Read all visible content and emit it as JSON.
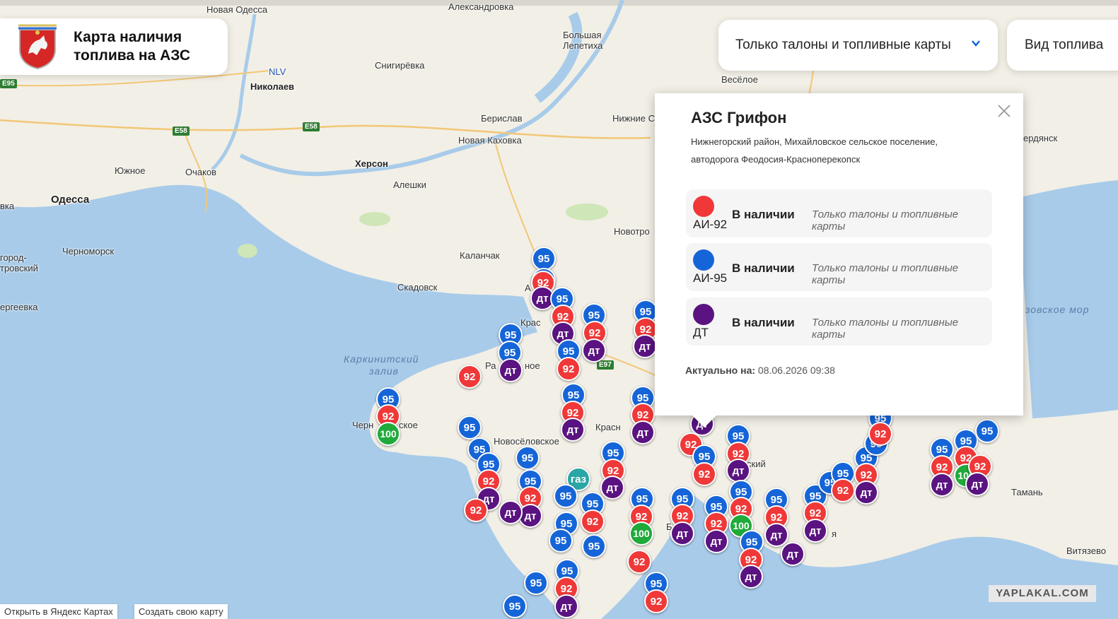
{
  "header": {
    "title": "Карта наличия топлива на АЗС",
    "filter_payment": "Только талоны и топливные карты",
    "filter_fuel": "Вид топлива"
  },
  "popup": {
    "station_name": "АЗС Грифон",
    "address": "Нижнегорский район, Михайловское сельское поселение, автодорога Феодосия-Красноперекопск",
    "fuels": [
      {
        "name": "АИ-92",
        "color": "#f03838",
        "status": "В наличии",
        "note": "Только талоны и топливные карты"
      },
      {
        "name": "АИ-95",
        "color": "#1565d8",
        "status": "В наличии",
        "note": "Только талоны и топливные карты"
      },
      {
        "name": "ДТ",
        "color": "#5a1380",
        "status": "В наличии",
        "note": "Только талоны и топливные карты"
      }
    ],
    "updated_label": "Актуально на:",
    "updated_value": "08.06.2026 09:38"
  },
  "map": {
    "places": {
      "novaya_odessa": "Новая Одесса",
      "aleksandrovka": "Александровка",
      "bolshaya_lepetikha": "Большая Лепетиха",
      "snigirevka": "Снигирёвка",
      "nlv": "NLV",
      "nikolaev": "Николаев",
      "veseloe": "Весёлое",
      "beryslav": "Берислав",
      "nizhnie": "Нижние С",
      "novaya_kakhovka": "Новая Каховка",
      "kherson": "Херсон",
      "yuzhnoe": "Южное",
      "ochakov": "Очаков",
      "aleshki": "Алешки",
      "odessa": "Одесса",
      "vka": "вка",
      "berdyansk": "ердянск",
      "novotroitsk": "Новотро",
      "kalanchak": "Каланчак",
      "gorod": "город-",
      "trovskiy": "тровский",
      "chernomorsk": "Черноморск",
      "skadovsk": "Скадовск",
      "ergeevka": "ергеевка",
      "azov_sea": "зовское мор",
      "karkinit": "Каркинитский",
      "zaliv": "залив",
      "cherno": "Черн",
      "skoe": "ское",
      "novoselovskoe": "Новосёловское",
      "kras": "Крас",
      "ra": "Ра",
      "noe": "ное",
      "krasn": "Красн",
      "a": "А",
      "skiy": "ский",
      "taman": "Тамань",
      "vityazevo": "Витязево",
      "ya": "я",
      "b": "Б"
    },
    "roads": {
      "e95": "E95",
      "e58a": "E58",
      "e58b": "E58",
      "e97": "E97"
    },
    "markers": [
      [
        "95",
        769,
        366
      ],
      [
        "95",
        769,
        396
      ],
      [
        "92",
        768,
        400
      ],
      [
        "дт",
        767,
        422
      ],
      [
        "95",
        795,
        423
      ],
      [
        "92",
        796,
        448
      ],
      [
        "дт",
        796,
        472
      ],
      [
        "95",
        840,
        446
      ],
      [
        "92",
        841,
        471
      ],
      [
        "дт",
        840,
        496
      ],
      [
        "95",
        913,
        441
      ],
      [
        "92",
        913,
        466
      ],
      [
        "дт",
        912,
        490
      ],
      [
        "95",
        722,
        474
      ],
      [
        "95",
        721,
        499
      ],
      [
        "дт",
        722,
        524
      ],
      [
        "92",
        664,
        533
      ],
      [
        "95",
        804,
        497
      ],
      [
        "92",
        804,
        522
      ],
      [
        "95",
        549,
        565
      ],
      [
        "92",
        549,
        589
      ],
      [
        "100",
        549,
        614
      ],
      [
        "95",
        811,
        559
      ],
      [
        "92",
        810,
        584
      ],
      [
        "дт",
        810,
        608
      ],
      [
        "95",
        909,
        563
      ],
      [
        "92",
        909,
        587
      ],
      [
        "дт",
        909,
        612
      ],
      [
        "95",
        664,
        605
      ],
      [
        "95",
        678,
        636
      ],
      [
        "95",
        691,
        657
      ],
      [
        "92",
        691,
        681
      ],
      [
        "дт",
        691,
        706
      ],
      [
        "95",
        746,
        648
      ],
      [
        "95",
        750,
        681
      ],
      [
        "92",
        750,
        705
      ],
      [
        "дт",
        750,
        730
      ],
      [
        "92",
        673,
        722
      ],
      [
        "дт",
        722,
        725
      ],
      [
        "95",
        867,
        641
      ],
      [
        "92",
        867,
        666
      ],
      [
        "дт",
        866,
        690
      ],
      [
        "газ",
        818,
        678
      ],
      [
        "95",
        800,
        702
      ],
      [
        "95",
        838,
        713
      ],
      [
        "92",
        838,
        738
      ],
      [
        "95",
        908,
        706
      ],
      [
        "92",
        907,
        731
      ],
      [
        "100",
        907,
        755
      ],
      [
        "95",
        801,
        741
      ],
      [
        "95",
        793,
        765
      ],
      [
        "95",
        840,
        773
      ],
      [
        "95",
        802,
        808
      ],
      [
        "92",
        801,
        833
      ],
      [
        "дт",
        801,
        858
      ],
      [
        "95",
        758,
        825
      ],
      [
        "95",
        728,
        858
      ],
      [
        "92",
        904,
        795
      ],
      [
        "95",
        928,
        826
      ],
      [
        "92",
        928,
        851
      ],
      [
        "95",
        993,
        575
      ],
      [
        "дт",
        993,
        600
      ],
      [
        "92",
        977,
        629
      ],
      [
        "95",
        996,
        646
      ],
      [
        "92",
        996,
        671
      ],
      [
        "95",
        965,
        706
      ],
      [
        "92",
        965,
        730
      ],
      [
        "дт",
        965,
        755
      ],
      [
        "95",
        1013,
        717
      ],
      [
        "92",
        1013,
        741
      ],
      [
        "дт",
        1013,
        766
      ],
      [
        "95",
        1044,
        617
      ],
      [
        "92",
        1044,
        642
      ],
      [
        "дт",
        1044,
        666
      ],
      [
        "95",
        1048,
        696
      ],
      [
        "92",
        1048,
        720
      ],
      [
        "100",
        1048,
        744
      ],
      [
        "95",
        1063,
        767
      ],
      [
        "92",
        1062,
        792
      ],
      [
        "дт",
        1062,
        816
      ],
      [
        "95",
        1098,
        707
      ],
      [
        "92",
        1098,
        732
      ],
      [
        "дт",
        1098,
        757
      ],
      [
        "95",
        1153,
        702
      ],
      [
        "92",
        1153,
        726
      ],
      [
        "дт",
        1153,
        751
      ],
      [
        "дт",
        1121,
        784
      ],
      [
        "95",
        1174,
        683
      ],
      [
        "95",
        1192,
        670
      ],
      [
        "92",
        1192,
        694
      ],
      [
        "95",
        1225,
        648
      ],
      [
        "92",
        1225,
        672
      ],
      [
        "дт",
        1225,
        697
      ],
      [
        "95",
        1239,
        628
      ],
      [
        "95",
        1245,
        592
      ],
      [
        "92",
        1245,
        614
      ],
      [
        "95",
        1332,
        636
      ],
      [
        "92",
        1332,
        661
      ],
      [
        "дт",
        1332,
        686
      ],
      [
        "95",
        1366,
        624
      ],
      [
        "92",
        1366,
        648
      ],
      [
        "100",
        1366,
        673
      ],
      [
        "95",
        1396,
        610
      ],
      [
        "92",
        1386,
        660
      ],
      [
        "дт",
        1382,
        685
      ]
    ]
  },
  "controls": {
    "open_yandex": "Открыть в Яндекс Картах",
    "create_map": "Создать свою карту",
    "watermark": "YAPLAKAL.COM"
  }
}
